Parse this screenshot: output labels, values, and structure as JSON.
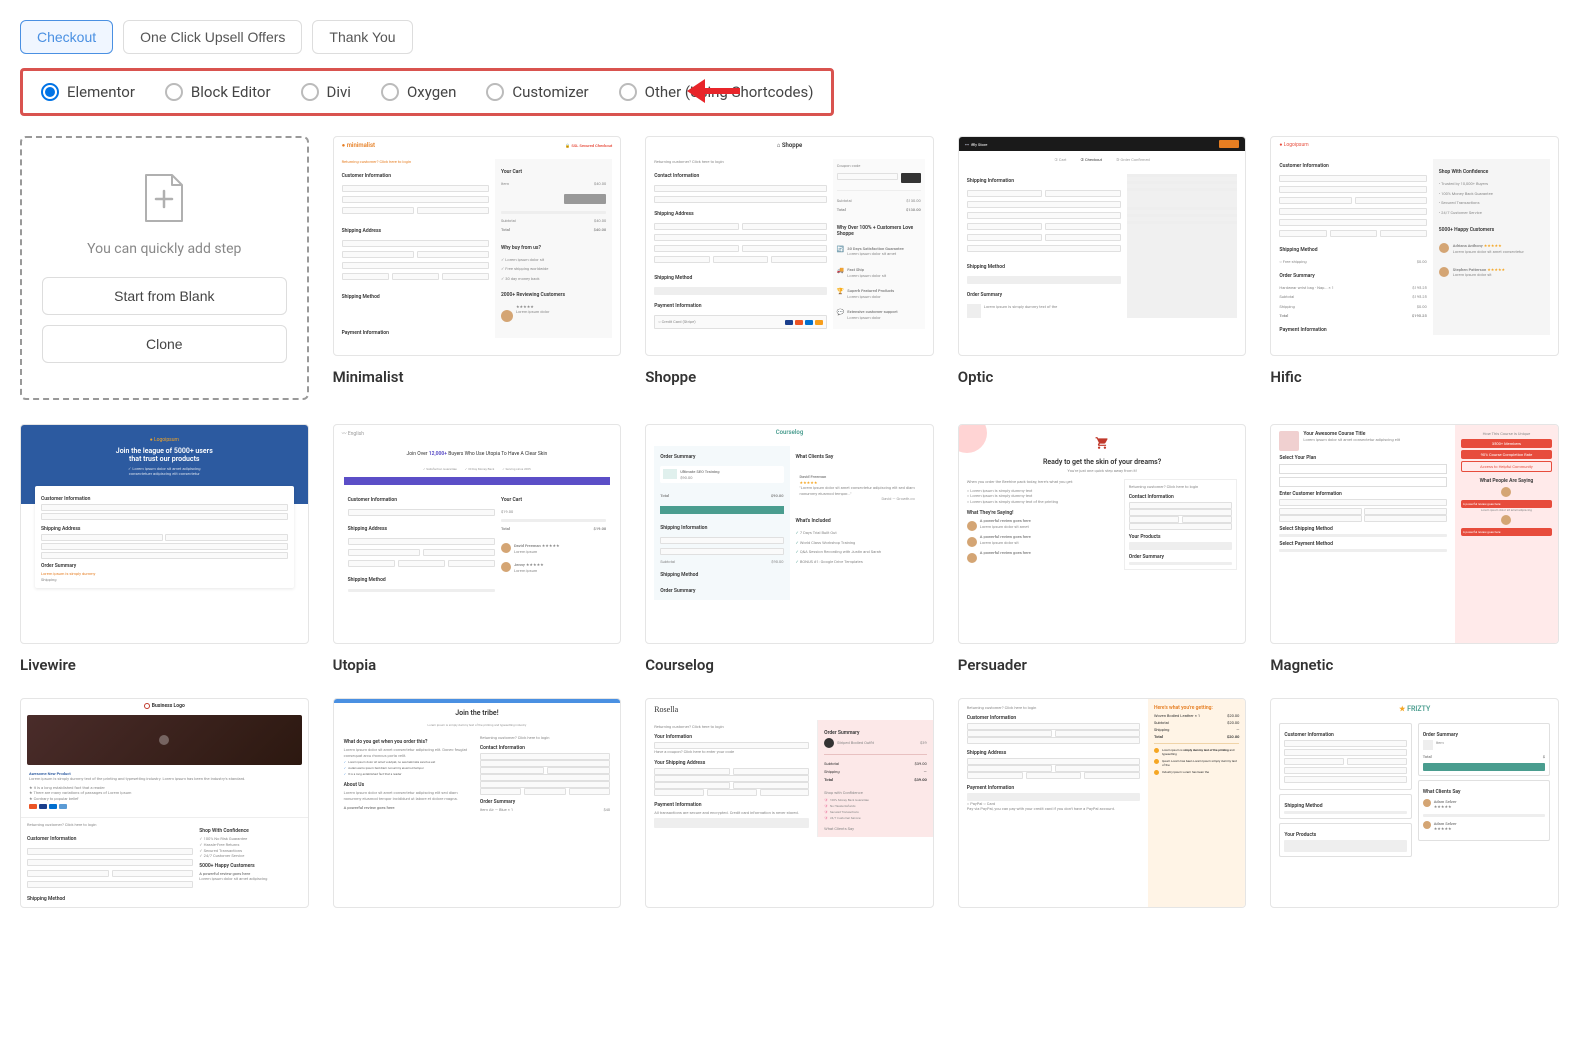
{
  "tabs": {
    "checkout": "Checkout",
    "upsell": "One Click Upsell Offers",
    "thankyou": "Thank You"
  },
  "builders": {
    "elementor": "Elementor",
    "block_editor": "Block Editor",
    "divi": "Divi",
    "oxygen": "Oxygen",
    "customizer": "Customizer",
    "other": "Other (Using Shortcodes)"
  },
  "blank_card": {
    "subtitle": "You can quickly add step",
    "start_btn": "Start from Blank",
    "clone_btn": "Clone"
  },
  "templates": {
    "minimalist": "Minimalist",
    "shoppe": "Shoppe",
    "optic": "Optic",
    "hific": "Hific",
    "livewire": "Livewire",
    "utopia": "Utopia",
    "courselog": "Courselog",
    "persuader": "Persuader",
    "magnetic": "Magnetic"
  }
}
